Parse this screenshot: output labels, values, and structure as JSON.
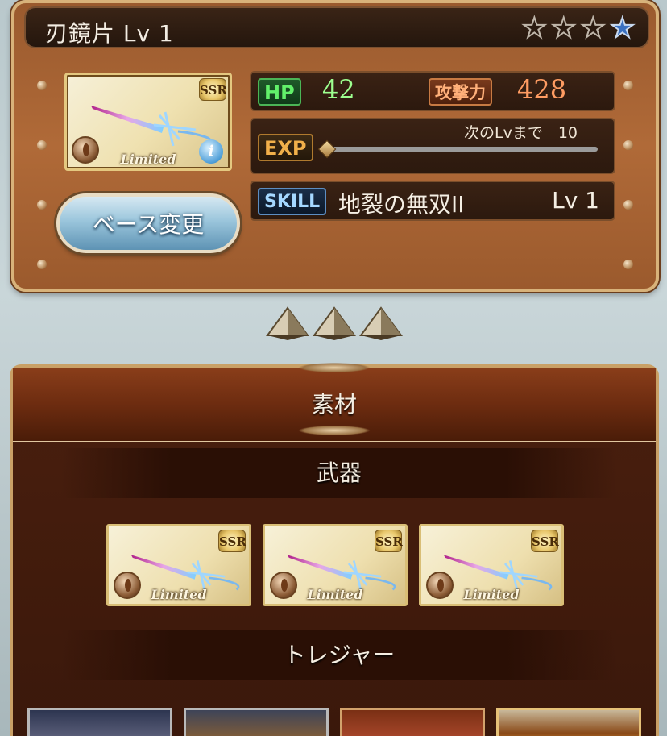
{
  "weapon": {
    "title": "刃鏡片 Lv 1",
    "stars_total": 4,
    "stars_filled": 1,
    "rarity": "SSR",
    "tag": "Limited",
    "info_glyph": "i"
  },
  "base_button": {
    "label": "ベース変更"
  },
  "stats": {
    "hp_label": "HP",
    "hp_value": "42",
    "atk_label": "攻撃力",
    "atk_value": "428",
    "exp_label": "EXP",
    "exp_next_text": "次のLvまで　10",
    "exp_progress": 0,
    "skill_label": "SKILL",
    "skill_name": "地裂の無双II",
    "skill_level": "Lv 1"
  },
  "materials": {
    "title": "素材",
    "weapons_heading": "武器",
    "weapon_cards": [
      {
        "rarity": "SSR",
        "tag": "Limited"
      },
      {
        "rarity": "SSR",
        "tag": "Limited"
      },
      {
        "rarity": "SSR",
        "tag": "Limited"
      }
    ],
    "treasure_heading": "トレジャー",
    "treasure_count": 4
  },
  "colors": {
    "hp": "#62f06a",
    "atk": "#ff9c62",
    "panel_brown": "#a8622f",
    "star_filled": "#3a70c0"
  }
}
